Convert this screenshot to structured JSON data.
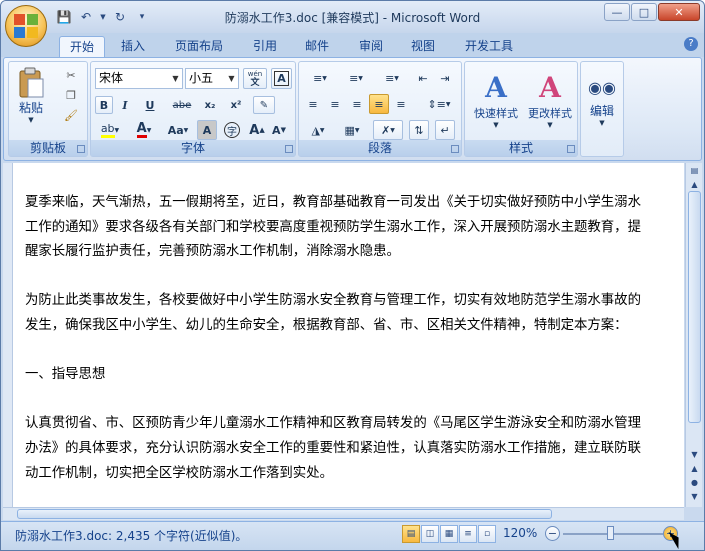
{
  "window": {
    "title": "防溺水工作3.doc [兼容模式] - Microsoft Word"
  },
  "quick_access": {
    "save_icon": "save-icon",
    "undo_icon": "undo-icon",
    "redo_icon": "redo-icon",
    "customize_icon": "customize-icon"
  },
  "tabs": [
    {
      "label": "开始"
    },
    {
      "label": "插入"
    },
    {
      "label": "页面布局"
    },
    {
      "label": "引用"
    },
    {
      "label": "邮件"
    },
    {
      "label": "审阅"
    },
    {
      "label": "视图"
    },
    {
      "label": "开发工具"
    }
  ],
  "ribbon": {
    "clipboard": {
      "label": "剪贴板",
      "paste": "粘贴"
    },
    "font": {
      "label": "字体",
      "font_name": "宋体",
      "font_size": "小五",
      "wen": "wén",
      "bold": "B",
      "italic": "I",
      "underline": "U",
      "strike": "abe",
      "subscript": "x₂",
      "superscript": "x²",
      "grow": "A",
      "shrink": "A",
      "change_case": "Aa",
      "char_shading": "A",
      "enclose": "字",
      "char_border": "A"
    },
    "paragraph": {
      "label": "段落"
    },
    "styles": {
      "label": "样式",
      "quick": "快速样式",
      "change": "更改样式"
    },
    "editing": {
      "label": "编辑"
    }
  },
  "document": {
    "paragraphs": [
      "夏季来临，天气渐热，五一假期将至，近日，教育部基础教育一司发出《关于切实做好预防中小学生溺水",
      "工作的通知》要求各级各有关部门和学校要高度重视预防学生溺水工作，深入开展预防溺水主题教育，提",
      "醒家长履行监护责任，完善预防溺水工作机制，消除溺水隐患。",
      "",
      "为防止此类事故发生，各校要做好中小学生防溺水安全教育与管理工作，切实有效地防范学生溺水事故的",
      "发生，确保我区中小学生、幼儿的生命安全，根据教育部、省、市、区相关文件精神，特制定本方案：",
      "",
      "一、指导思想",
      "",
      "认真贯彻省、市、区预防青少年儿童溺水工作精神和区教育局转发的《马尾区学生游泳安全和防溺水管理",
      "办法》的具体要求，充分认识防溺水安全工作的重要性和紧迫性，认真落实防溺水工作措施，建立联防联",
      "动工作机制，切实把全区学校防溺水工作落到实处。"
    ]
  },
  "status": {
    "text": "防溺水工作3.doc: 2,435 个字符(近似值)。",
    "zoom": "120%",
    "zoom_minus": "−",
    "zoom_plus": "+"
  }
}
